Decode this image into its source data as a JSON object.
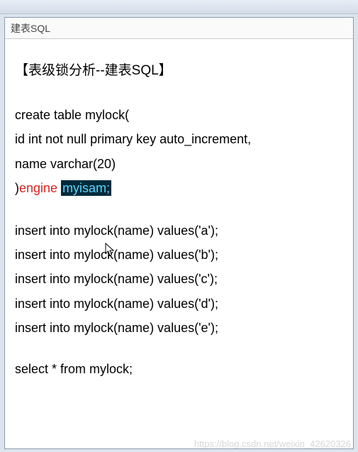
{
  "tab": {
    "label": "建表SQL"
  },
  "section": {
    "title_open": "【表级锁分析--建表SQL】"
  },
  "sql": {
    "create": {
      "l1": "create table mylock(",
      "l2": " id int not null primary key auto_increment,",
      "l3": " name varchar(20)",
      "close_paren": ")",
      "engine_kw": "engine ",
      "engine_val": "myisam;"
    },
    "inserts": [
      "insert into mylock(name) values('a');",
      "insert into mylock(name) values('b');",
      "insert into mylock(name) values('c');",
      "insert into mylock(name) values('d');",
      "insert into mylock(name) values('e');"
    ],
    "select": "select * from mylock;"
  },
  "watermark": "https://blog.csdn.net/weixin_42620326"
}
